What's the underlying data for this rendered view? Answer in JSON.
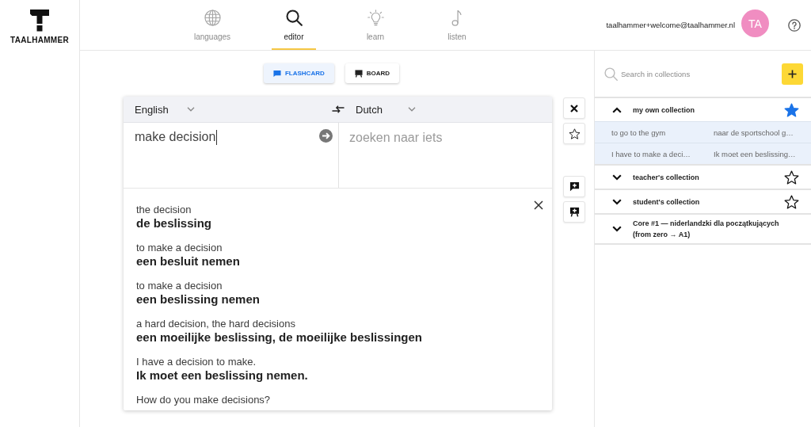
{
  "logo": {
    "text": "TAALHAMMER"
  },
  "nav": [
    {
      "label": "languages",
      "selected": false
    },
    {
      "label": "editor",
      "selected": true
    },
    {
      "label": "learn",
      "selected": false
    },
    {
      "label": "listen",
      "selected": false
    }
  ],
  "user": {
    "email": "taalhammer+welcome@taalhammer.nl",
    "initials": "TA"
  },
  "modes": [
    {
      "label": "FLASHCARD",
      "selected": true
    },
    {
      "label": "BOARD",
      "selected": false
    }
  ],
  "translator": {
    "source_language": "English",
    "target_language": "Dutch",
    "input": "make decision",
    "output_placeholder": "zoeken naar iets"
  },
  "suggestions": [
    {
      "source": "the decision",
      "target": "de beslissing"
    },
    {
      "source": "to make a decision",
      "target": "een besluit nemen"
    },
    {
      "source": "to make a decision",
      "target": "een beslissing nemen"
    },
    {
      "source": "a hard decision, the hard decisions",
      "target": "een moeilijke beslissing, de moeilijke beslissingen"
    },
    {
      "source": "I have a decision to make.",
      "target": "Ik moet een beslissing nemen."
    },
    {
      "source": "How do you make decisions?"
    }
  ],
  "search": {
    "placeholder": "Search in collections"
  },
  "collections": [
    {
      "title": "my own collection",
      "expanded": true,
      "starred": true,
      "entries": [
        {
          "source": "to go to the gym",
          "target": "naar de sportschool g…"
        },
        {
          "source": "I have to make a deci…",
          "target": "Ik moet een beslissing…"
        }
      ]
    },
    {
      "title": "teacher's collection",
      "expanded": false,
      "starred": false
    },
    {
      "title": "student's collection",
      "expanded": false,
      "starred": false
    },
    {
      "title": "Core #1 — niderlandzki dla początkujących (from zero → A1)",
      "expanded": false
    }
  ]
}
